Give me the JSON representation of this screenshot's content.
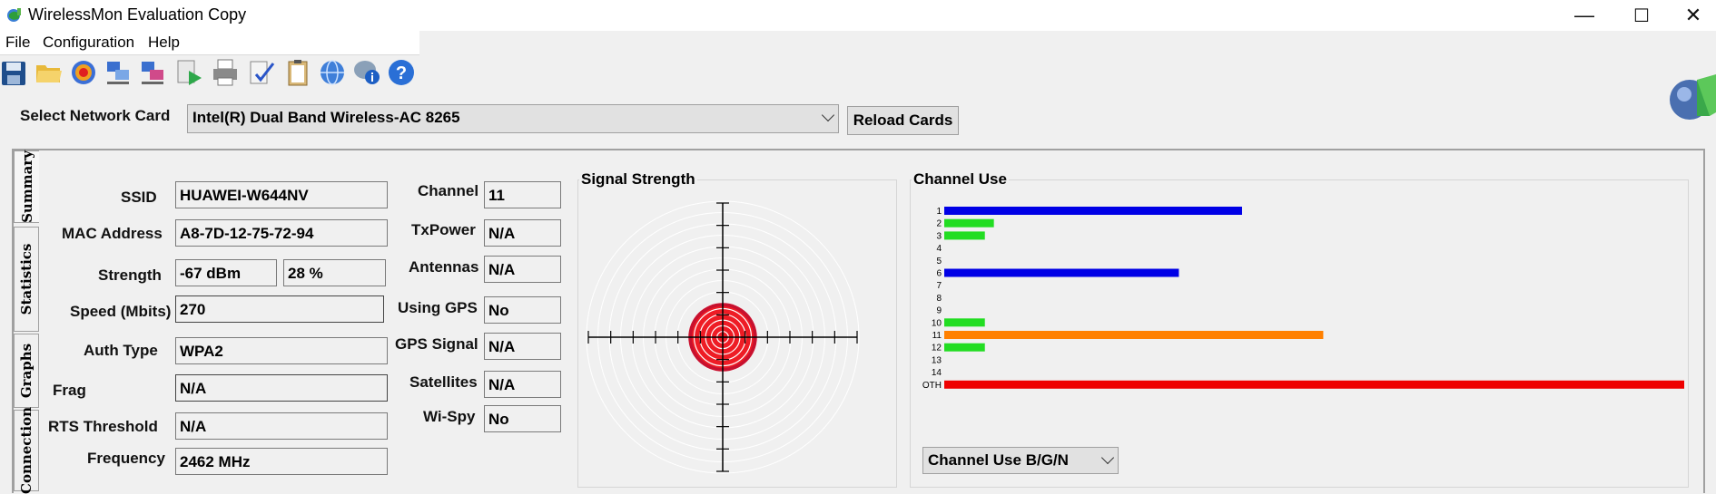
{
  "window": {
    "title": "WirelessMon Evaluation Copy",
    "minimize": "—",
    "maximize": "☐",
    "close": "✕"
  },
  "menu": [
    "File",
    "Configuration",
    "Help"
  ],
  "toolbar_icons": [
    "save-icon",
    "open-folder-icon",
    "target-icon",
    "network-cards-icon",
    "network-cards-alt-icon",
    "play-log-icon",
    "printer-icon",
    "check-report-icon",
    "clipboard-icon",
    "globe-icon",
    "info-chat-icon",
    "help-icon"
  ],
  "network_card": {
    "label": "Select Network Card",
    "selected": "Intel(R) Dual Band Wireless-AC 8265",
    "reload_label": "Reload Cards"
  },
  "tabs": [
    "Summary",
    "Statistics",
    "Graphs",
    "Connection"
  ],
  "summary": {
    "left": [
      {
        "label": "SSID",
        "value": "HUAWEI-W644NV"
      },
      {
        "label": "MAC Address",
        "value": "A8-7D-12-75-72-94"
      },
      {
        "label": "Strength",
        "value": "-67 dBm",
        "value2": "28 %"
      },
      {
        "label": "Speed (Mbits)",
        "value": "270"
      },
      {
        "label": "Auth Type",
        "value": "WPA2"
      },
      {
        "label": "Frag",
        "value": "N/A"
      },
      {
        "label": "RTS Threshold",
        "value": "N/A"
      },
      {
        "label": "Frequency",
        "value": "2462 MHz"
      }
    ],
    "right": [
      {
        "label": "Channel",
        "value": "11"
      },
      {
        "label": "TxPower",
        "value": "N/A"
      },
      {
        "label": "Antennas",
        "value": "N/A"
      },
      {
        "label": "Using GPS",
        "value": "No"
      },
      {
        "label": "GPS Signal",
        "value": "N/A"
      },
      {
        "label": "Satellites",
        "value": "N/A"
      },
      {
        "label": "Wi-Spy",
        "value": "No"
      }
    ]
  },
  "signal_strength": {
    "title": "Signal Strength",
    "percent": 28
  },
  "channel_use": {
    "title": "Channel Use",
    "mode_selected": "Channel Use B/G/N",
    "colors": {
      "blue": "#0000e6",
      "green": "#22dd22",
      "orange": "#ff8000",
      "red": "#ee0000"
    }
  },
  "chart_data": {
    "type": "bar",
    "orientation": "horizontal",
    "title": "Channel Use",
    "categories": [
      "1",
      "2",
      "3",
      "4",
      "5",
      "6",
      "7",
      "8",
      "9",
      "10",
      "11",
      "12",
      "13",
      "14",
      "OTH"
    ],
    "values": [
      330,
      55,
      45,
      0,
      0,
      260,
      0,
      0,
      0,
      45,
      420,
      45,
      0,
      0,
      820
    ],
    "bar_colors": [
      "blue",
      "green",
      "green",
      "",
      "",
      "blue",
      "",
      "",
      "",
      "green",
      "orange",
      "green",
      "",
      "",
      "red"
    ]
  }
}
